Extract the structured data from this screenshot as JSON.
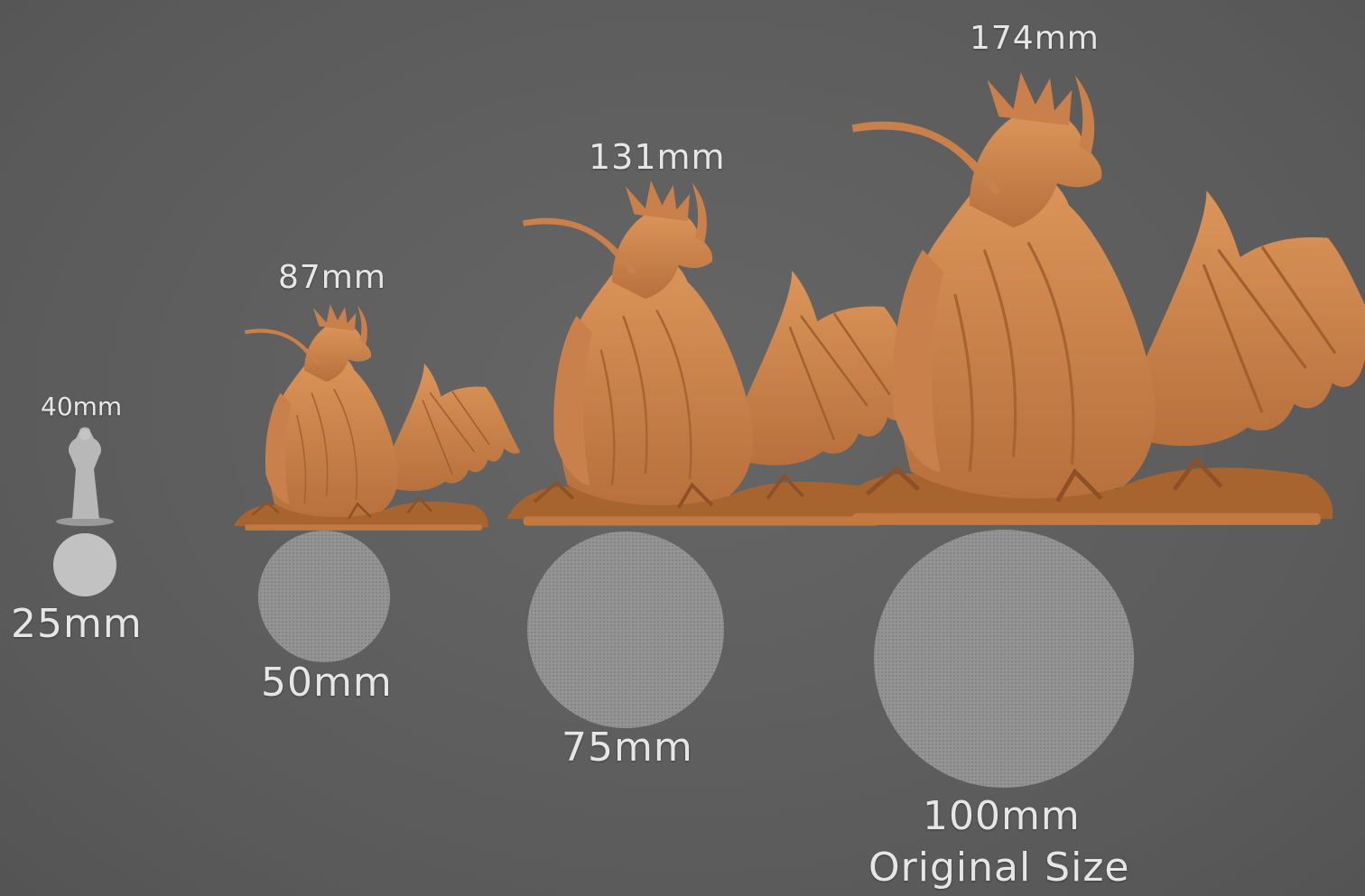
{
  "heights": {
    "human": "40mm",
    "small": "87mm",
    "medium": "131mm",
    "large": "174mm"
  },
  "bases": {
    "human": "25mm",
    "small": "50mm",
    "medium": "75mm",
    "large": "100mm",
    "large_note": "Original Size"
  },
  "colors": {
    "background": "#5e5e5e",
    "dragon": "#d4894f",
    "human_figure": "#b8b8b8",
    "base_disc": "#8e8e8e",
    "text": "#e6e6e6"
  }
}
